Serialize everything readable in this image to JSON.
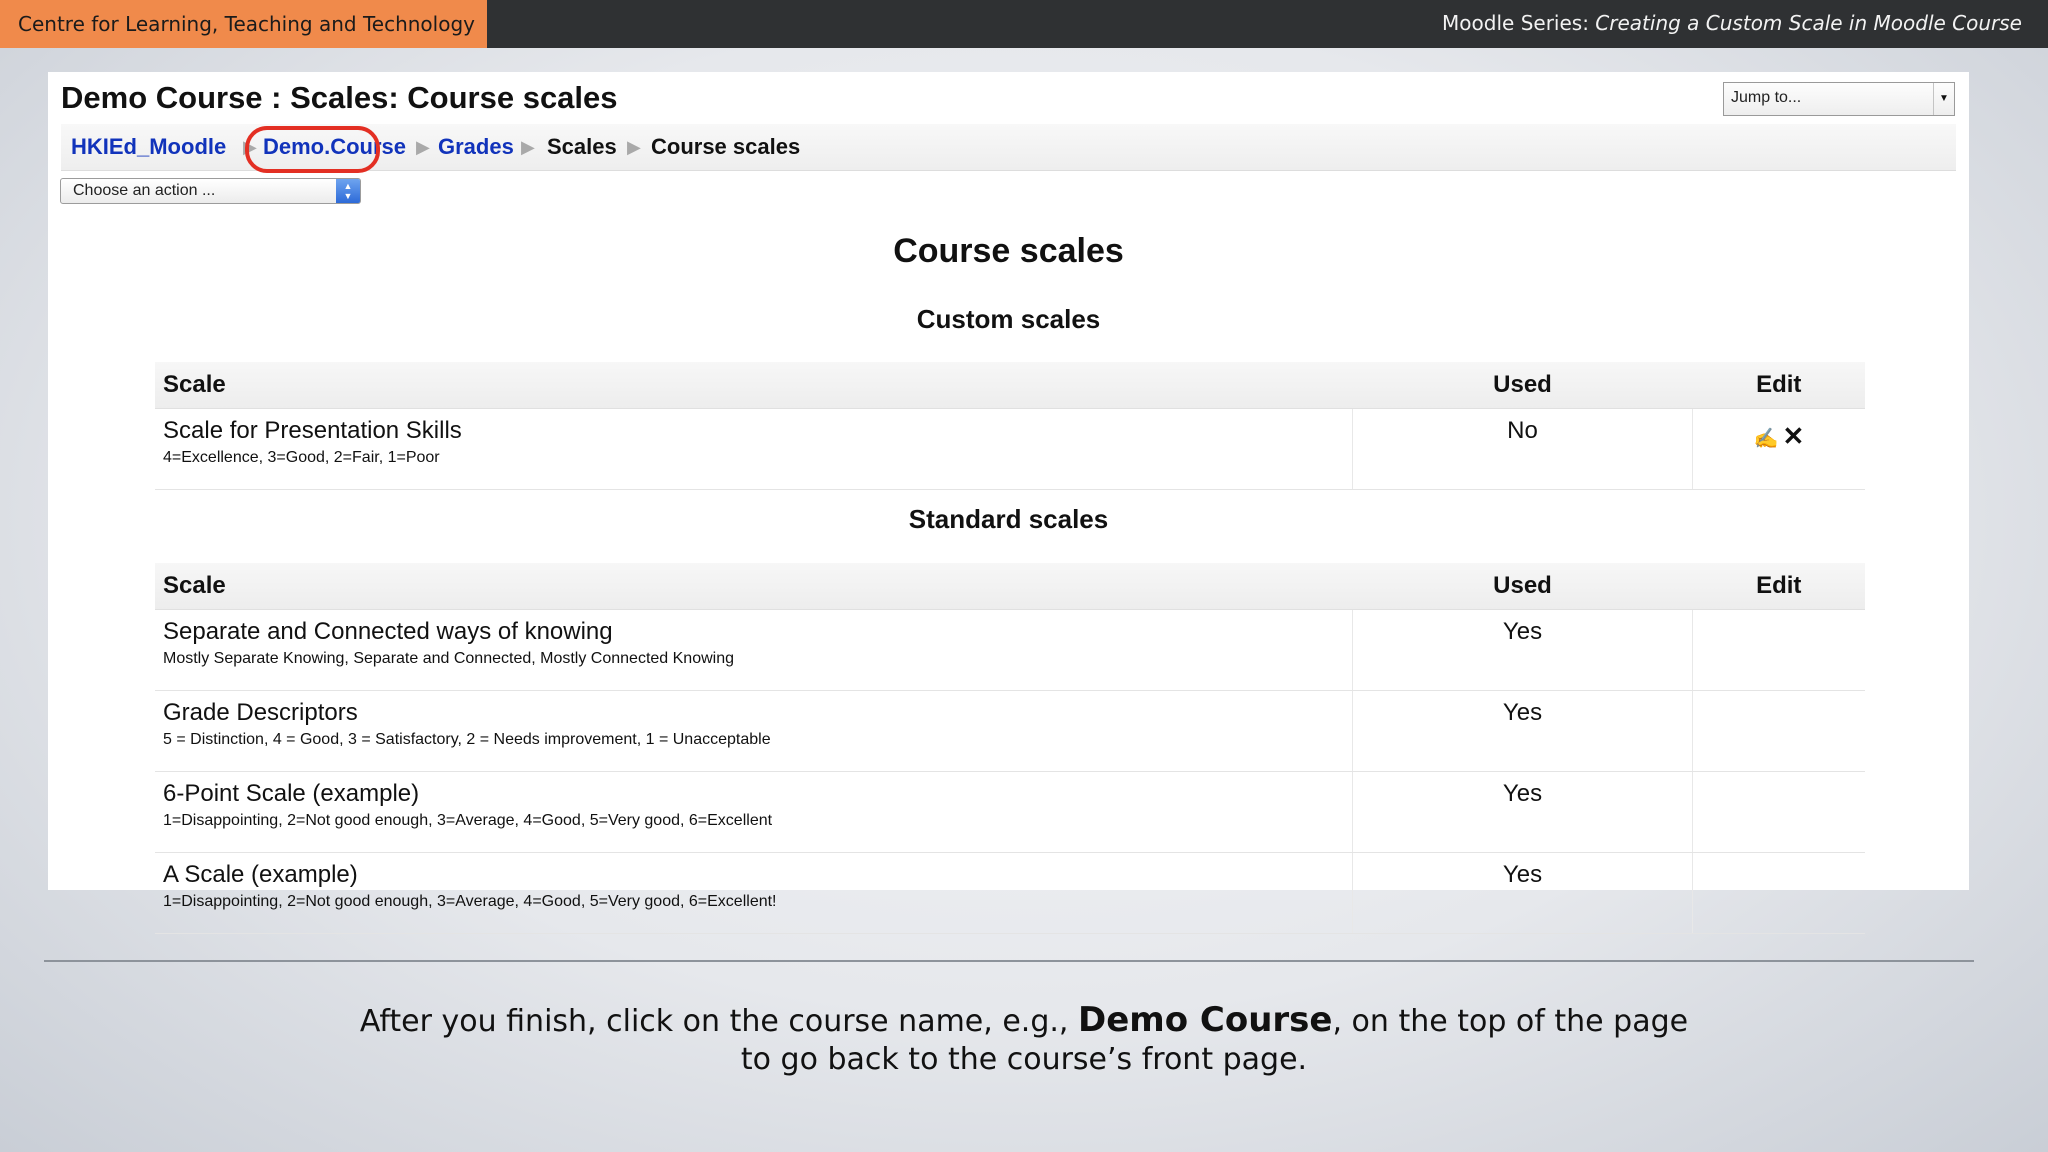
{
  "banner": {
    "org": "Centre for Learning, Teaching and Technology",
    "series_prefix": "Moodle Series: ",
    "series_title": "Creating a Custom Scale in Moodle Course"
  },
  "header": {
    "title": "Demo Course : Scales: Course scales",
    "jump_to": "Jump to..."
  },
  "breadcrumb": {
    "items": [
      "HKIEd_Moodle",
      "Demo.Course",
      "Grades",
      "Scales",
      "Course scales"
    ],
    "highlighted": "Demo.Course"
  },
  "action_select": {
    "value": "Choose an action ..."
  },
  "main": {
    "title": "Course scales",
    "custom_heading": "Custom scales",
    "standard_heading": "Standard scales",
    "columns": {
      "scale": "Scale",
      "used": "Used",
      "edit": "Edit"
    },
    "custom_scales": [
      {
        "name": "Scale for Presentation Skills",
        "items": "4=Excellence, 3=Good, 2=Fair, 1=Poor",
        "used": "No"
      }
    ],
    "standard_scales": [
      {
        "name": "Separate and Connected ways of knowing",
        "items": "Mostly Separate Knowing, Separate and Connected, Mostly Connected Knowing",
        "used": "Yes"
      },
      {
        "name": "Grade Descriptors",
        "items": "5 = Distinction, 4 = Good, 3 = Satisfactory, 2 = Needs improvement, 1 = Unacceptable",
        "used": "Yes"
      },
      {
        "name": "6-Point Scale (example)",
        "items": "1=Disappointing, 2=Not good enough, 3=Average, 4=Good, 5=Very good, 6=Excellent",
        "used": "Yes"
      },
      {
        "name": "A Scale (example)",
        "items": "1=Disappointing, 2=Not good enough, 3=Average, 4=Good, 5=Very good, 6=Excellent!",
        "used": "Yes"
      }
    ]
  },
  "caption": {
    "line1_before": "After you finish, click on the course name, e.g., ",
    "line1_bold": "Demo Course",
    "line1_after": ", on the top of the page",
    "line2": "to go back to the course’s front page."
  },
  "colors": {
    "accent_orange": "#f08a4b",
    "link_blue": "#1133bb",
    "highlight_red": "#e32f23",
    "banner_dark": "#2f3133"
  },
  "icons": {
    "edit": "edit-icon",
    "delete": "delete-icon",
    "separator": "breadcrumb-arrow-icon"
  }
}
